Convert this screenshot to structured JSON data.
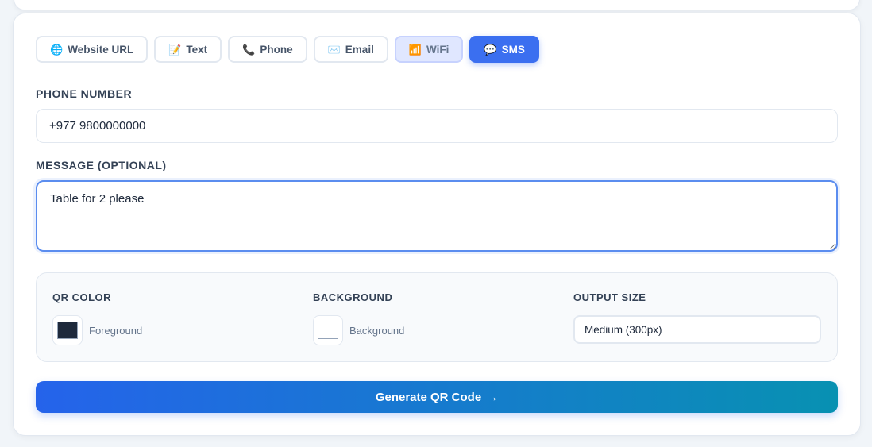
{
  "tabs": [
    {
      "icon": "🌐",
      "icon_name": "globe-icon",
      "label": "Website URL"
    },
    {
      "icon": "📝",
      "icon_name": "memo-icon",
      "label": "Text"
    },
    {
      "icon": "📞",
      "icon_name": "phone-icon",
      "label": "Phone"
    },
    {
      "icon": "✉️",
      "icon_name": "envelope-icon",
      "label": "Email"
    },
    {
      "icon": "📶",
      "icon_name": "wifi-icon",
      "label": "WiFi"
    },
    {
      "icon": "💬",
      "icon_name": "chat-icon",
      "label": "SMS"
    }
  ],
  "active_tab": "SMS",
  "form": {
    "phone_label": "PHONE NUMBER",
    "phone_value": "+977 9800000000",
    "message_label": "MESSAGE (OPTIONAL)",
    "message_value": "Table for 2 please"
  },
  "options": {
    "qr_color_label": "QR COLOR",
    "qr_color_text": "Foreground",
    "qr_color_value": "#1e293b",
    "background_label": "BACKGROUND",
    "background_text": "Background",
    "background_value": "#ffffff",
    "output_size_label": "OUTPUT SIZE",
    "output_size_value": "Medium (300px)"
  },
  "generate": {
    "label": "Generate QR Code",
    "arrow": "→"
  },
  "colors": {
    "accent": "#3b6ff0",
    "gradient_start": "#2563eb",
    "gradient_end": "#0891b2"
  }
}
